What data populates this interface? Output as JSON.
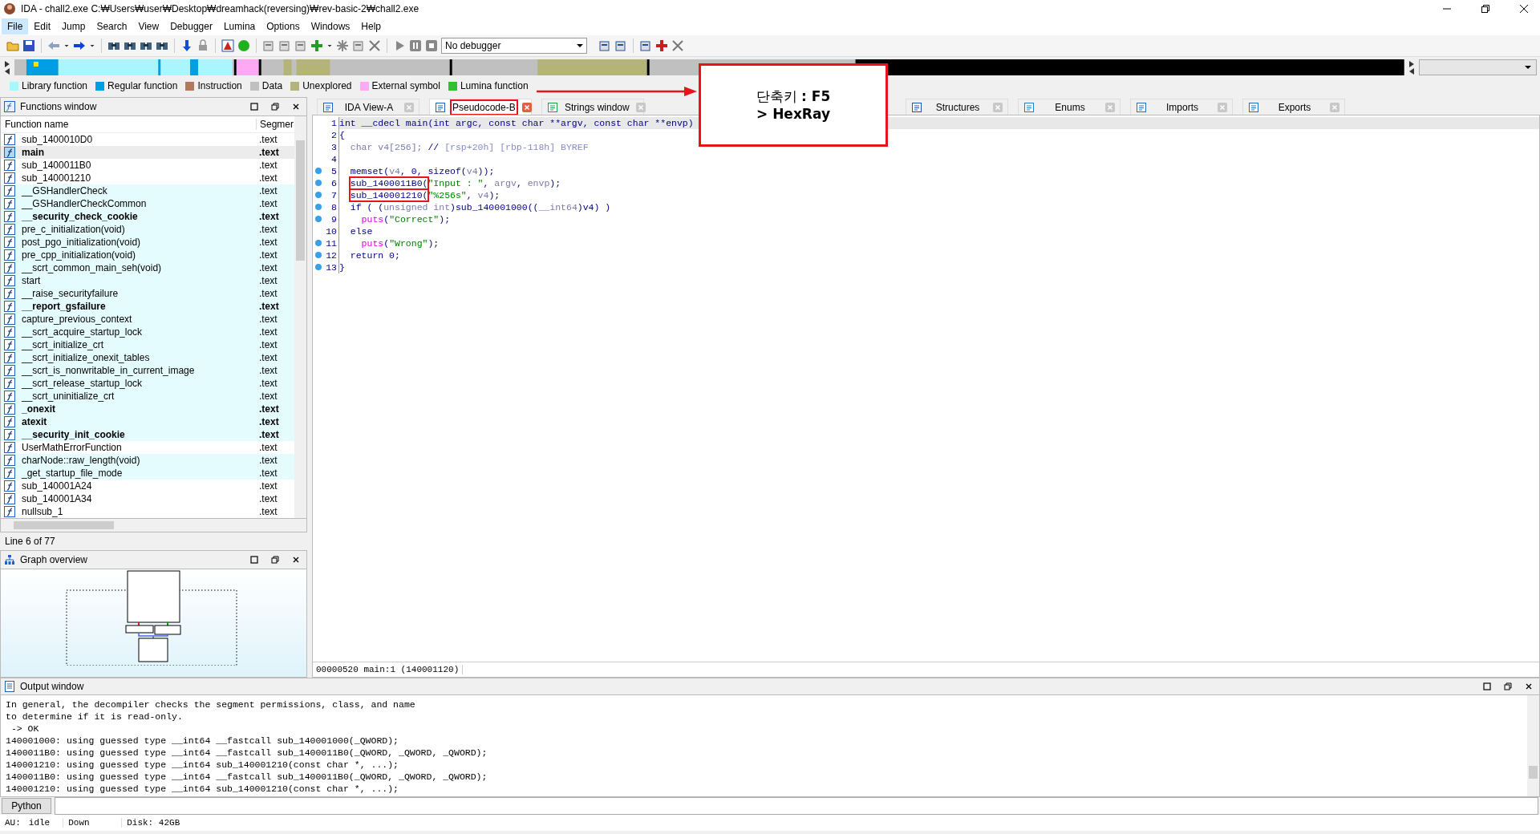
{
  "window": {
    "title": "IDA - chall2.exe C:₩Users₩user₩Desktop₩dreamhack(reversing)₩rev-basic-2₩chall2.exe"
  },
  "menu": [
    {
      "label": "File",
      "selected": true
    },
    {
      "label": "Edit",
      "selected": false
    },
    {
      "label": "Jump",
      "selected": false
    },
    {
      "label": "Search",
      "selected": false
    },
    {
      "label": "View",
      "selected": false
    },
    {
      "label": "Debugger",
      "selected": false
    },
    {
      "label": "Lumina",
      "selected": false
    },
    {
      "label": "Options",
      "selected": false
    },
    {
      "label": "Windows",
      "selected": false
    },
    {
      "label": "Help",
      "selected": false
    }
  ],
  "toolbar": {
    "debugger_select": "No debugger"
  },
  "legend": [
    {
      "label": "Library function",
      "color": "#aaf6ff"
    },
    {
      "label": "Regular function",
      "color": "#009fe3"
    },
    {
      "label": "Instruction",
      "color": "#b4785a"
    },
    {
      "label": "Data",
      "color": "#c0c0c0"
    },
    {
      "label": "Unexplored",
      "color": "#b4b478"
    },
    {
      "label": "External symbol",
      "color": "#ffa8f4"
    },
    {
      "label": "Lumina function",
      "color": "#30c030"
    }
  ],
  "functions_window": {
    "title": "Functions window",
    "columns": [
      "Function name",
      "Segmer"
    ],
    "rows": [
      {
        "name": "sub_1400010D0",
        "segment": ".text",
        "bold": false,
        "library": false,
        "selected": false
      },
      {
        "name": "main",
        "segment": ".text",
        "bold": true,
        "library": false,
        "selected": true
      },
      {
        "name": "sub_1400011B0",
        "segment": ".text",
        "bold": false,
        "library": false,
        "selected": false
      },
      {
        "name": "sub_140001210",
        "segment": ".text",
        "bold": false,
        "library": false,
        "selected": false
      },
      {
        "name": "__GSHandlerCheck",
        "segment": ".text",
        "bold": false,
        "library": true,
        "selected": false
      },
      {
        "name": "__GSHandlerCheckCommon",
        "segment": ".text",
        "bold": false,
        "library": true,
        "selected": false
      },
      {
        "name": "__security_check_cookie",
        "segment": ".text",
        "bold": true,
        "library": true,
        "selected": false
      },
      {
        "name": "pre_c_initialization(void)",
        "segment": ".text",
        "bold": false,
        "library": true,
        "selected": false
      },
      {
        "name": "post_pgo_initialization(void)",
        "segment": ".text",
        "bold": false,
        "library": true,
        "selected": false
      },
      {
        "name": "pre_cpp_initialization(void)",
        "segment": ".text",
        "bold": false,
        "library": true,
        "selected": false
      },
      {
        "name": "__scrt_common_main_seh(void)",
        "segment": ".text",
        "bold": false,
        "library": true,
        "selected": false
      },
      {
        "name": "start",
        "segment": ".text",
        "bold": false,
        "library": true,
        "selected": false
      },
      {
        "name": "__raise_securityfailure",
        "segment": ".text",
        "bold": false,
        "library": true,
        "selected": false
      },
      {
        "name": "__report_gsfailure",
        "segment": ".text",
        "bold": true,
        "library": true,
        "selected": false
      },
      {
        "name": "capture_previous_context",
        "segment": ".text",
        "bold": false,
        "library": true,
        "selected": false
      },
      {
        "name": "__scrt_acquire_startup_lock",
        "segment": ".text",
        "bold": false,
        "library": true,
        "selected": false
      },
      {
        "name": "__scrt_initialize_crt",
        "segment": ".text",
        "bold": false,
        "library": true,
        "selected": false
      },
      {
        "name": "__scrt_initialize_onexit_tables",
        "segment": ".text",
        "bold": false,
        "library": true,
        "selected": false
      },
      {
        "name": "__scrt_is_nonwritable_in_current_image",
        "segment": ".text",
        "bold": false,
        "library": true,
        "selected": false
      },
      {
        "name": "__scrt_release_startup_lock",
        "segment": ".text",
        "bold": false,
        "library": true,
        "selected": false
      },
      {
        "name": "__scrt_uninitialize_crt",
        "segment": ".text",
        "bold": false,
        "library": true,
        "selected": false
      },
      {
        "name": "_onexit",
        "segment": ".text",
        "bold": true,
        "library": true,
        "selected": false
      },
      {
        "name": "atexit",
        "segment": ".text",
        "bold": true,
        "library": true,
        "selected": false
      },
      {
        "name": "__security_init_cookie",
        "segment": ".text",
        "bold": true,
        "library": true,
        "selected": false
      },
      {
        "name": "UserMathErrorFunction",
        "segment": ".text",
        "bold": false,
        "library": false,
        "selected": false
      },
      {
        "name": "charNode::raw_length(void)",
        "segment": ".text",
        "bold": false,
        "library": true,
        "selected": false
      },
      {
        "name": "_get_startup_file_mode",
        "segment": ".text",
        "bold": false,
        "library": true,
        "selected": false
      },
      {
        "name": "sub_140001A24",
        "segment": ".text",
        "bold": false,
        "library": false,
        "selected": false
      },
      {
        "name": "sub_140001A34",
        "segment": ".text",
        "bold": false,
        "library": false,
        "selected": false
      },
      {
        "name": "nullsub_1",
        "segment": ".text",
        "bold": false,
        "library": false,
        "selected": false
      }
    ],
    "status": "Line 6 of 77"
  },
  "graph_overview": {
    "title": "Graph overview"
  },
  "tabs": [
    {
      "label": "IDA View-A",
      "selected": false,
      "marked": false
    },
    {
      "label": "Pseudocode-B",
      "selected": true,
      "marked": true
    },
    {
      "label": "Strings window",
      "selected": false,
      "marked": false
    },
    {
      "label": "Structures",
      "selected": false,
      "marked": false
    },
    {
      "label": "Enums",
      "selected": false,
      "marked": false
    },
    {
      "label": "Imports",
      "selected": false,
      "marked": false
    },
    {
      "label": "Exports",
      "selected": false,
      "marked": false
    }
  ],
  "pseudocode": {
    "lines": [
      {
        "number": "1",
        "dot": false,
        "current": true,
        "segs": [
          {
            "kind": "code",
            "text": "int __cdecl main(int argc, const char **argv, const char **envp)"
          }
        ]
      },
      {
        "number": "2",
        "dot": false,
        "current": false,
        "segs": [
          {
            "kind": "code",
            "text": "{"
          }
        ]
      },
      {
        "number": "3",
        "dot": false,
        "current": false,
        "segs": [
          {
            "kind": "var",
            "text": "  char v4[256]; "
          },
          {
            "kind": "code",
            "text": "// "
          },
          {
            "kind": "cmt",
            "text": "[rsp+20h] [rbp-118h] BYREF"
          }
        ]
      },
      {
        "number": "4",
        "dot": false,
        "current": false
      },
      {
        "number": "5",
        "dot": true,
        "current": false,
        "segs": [
          {
            "kind": "code",
            "text": "  memset("
          },
          {
            "kind": "var",
            "text": "v4"
          },
          {
            "kind": "code",
            "text": ", 0, sizeof("
          },
          {
            "kind": "var",
            "text": "v4"
          },
          {
            "kind": "code",
            "text": "));"
          }
        ]
      },
      {
        "number": "6",
        "dot": true,
        "current": false,
        "segs": [
          {
            "kind": "code",
            "text": "  sub_1400011B0(",
            "marked": true
          },
          {
            "kind": "str",
            "text": "\"Input : \""
          },
          {
            "kind": "code",
            "text": ", "
          },
          {
            "kind": "var",
            "text": "argv"
          },
          {
            "kind": "code",
            "text": ", "
          },
          {
            "kind": "var",
            "text": "envp"
          },
          {
            "kind": "code",
            "text": ");"
          }
        ]
      },
      {
        "number": "7",
        "dot": true,
        "current": false,
        "segs": [
          {
            "kind": "code",
            "text": "  sub_140001210(",
            "marked": true
          },
          {
            "kind": "str",
            "text": "\"%256s\""
          },
          {
            "kind": "code",
            "text": ", "
          },
          {
            "kind": "var",
            "text": "v4"
          },
          {
            "kind": "code",
            "text": ");"
          }
        ]
      },
      {
        "number": "8",
        "dot": true,
        "current": false,
        "segs": [
          {
            "kind": "code",
            "text": "  if ( ("
          },
          {
            "kind": "var",
            "text": "unsigned int"
          },
          {
            "kind": "code",
            "text": ")sub_140001000(("
          },
          {
            "kind": "var",
            "text": "__int64"
          },
          {
            "kind": "code",
            "text": ")v4) )"
          }
        ]
      },
      {
        "number": "9",
        "dot": true,
        "current": false,
        "segs": [
          {
            "kind": "lib",
            "text": "    puts"
          },
          {
            "kind": "code",
            "text": "("
          },
          {
            "kind": "str",
            "text": "\"Correct\""
          },
          {
            "kind": "code",
            "text": ");"
          }
        ]
      },
      {
        "number": "10",
        "dot": false,
        "current": false,
        "segs": [
          {
            "kind": "code",
            "text": "  else"
          }
        ]
      },
      {
        "number": "11",
        "dot": true,
        "current": false,
        "segs": [
          {
            "kind": "lib",
            "text": "    puts"
          },
          {
            "kind": "code",
            "text": "("
          },
          {
            "kind": "str",
            "text": "\"Wrong\""
          },
          {
            "kind": "code",
            "text": ");"
          }
        ]
      },
      {
        "number": "12",
        "dot": true,
        "current": false,
        "segs": [
          {
            "kind": "code",
            "text": "  return 0;"
          }
        ]
      },
      {
        "number": "13",
        "dot": true,
        "current": false,
        "segs": [
          {
            "kind": "code",
            "text": "}"
          }
        ]
      }
    ],
    "status": "00000520 main:1 (140001120)"
  },
  "callout": {
    "lines": [
      {
        "text": "단축키 **: F5**",
        "bold": false
      },
      {
        "text": "> HexRay",
        "bold": true
      }
    ]
  },
  "output_window": {
    "title": "Output window",
    "lines": [
      "In general, the decompiler checks the segment permissions, class, and name",
      "to determine if it is read-only.",
      " -> OK",
      "140001000: using guessed type __int64 __fastcall sub_140001000(_QWORD);",
      "1400011B0: using guessed type __int64 __fastcall sub_1400011B0(_QWORD, _QWORD, _QWORD);",
      "140001210: using guessed type __int64 sub_140001210(const char *, ...);",
      "1400011B0: using guessed type __int64 __fastcall sub_1400011B0(_QWORD, _QWORD, _QWORD);",
      "140001210: using guessed type __int64 sub_140001210(const char *, ...);"
    ]
  },
  "command_line": {
    "button": "Python"
  },
  "status_bar": [
    "AU:",
    "idle",
    "Down",
    "Disk: 42GB"
  ]
}
